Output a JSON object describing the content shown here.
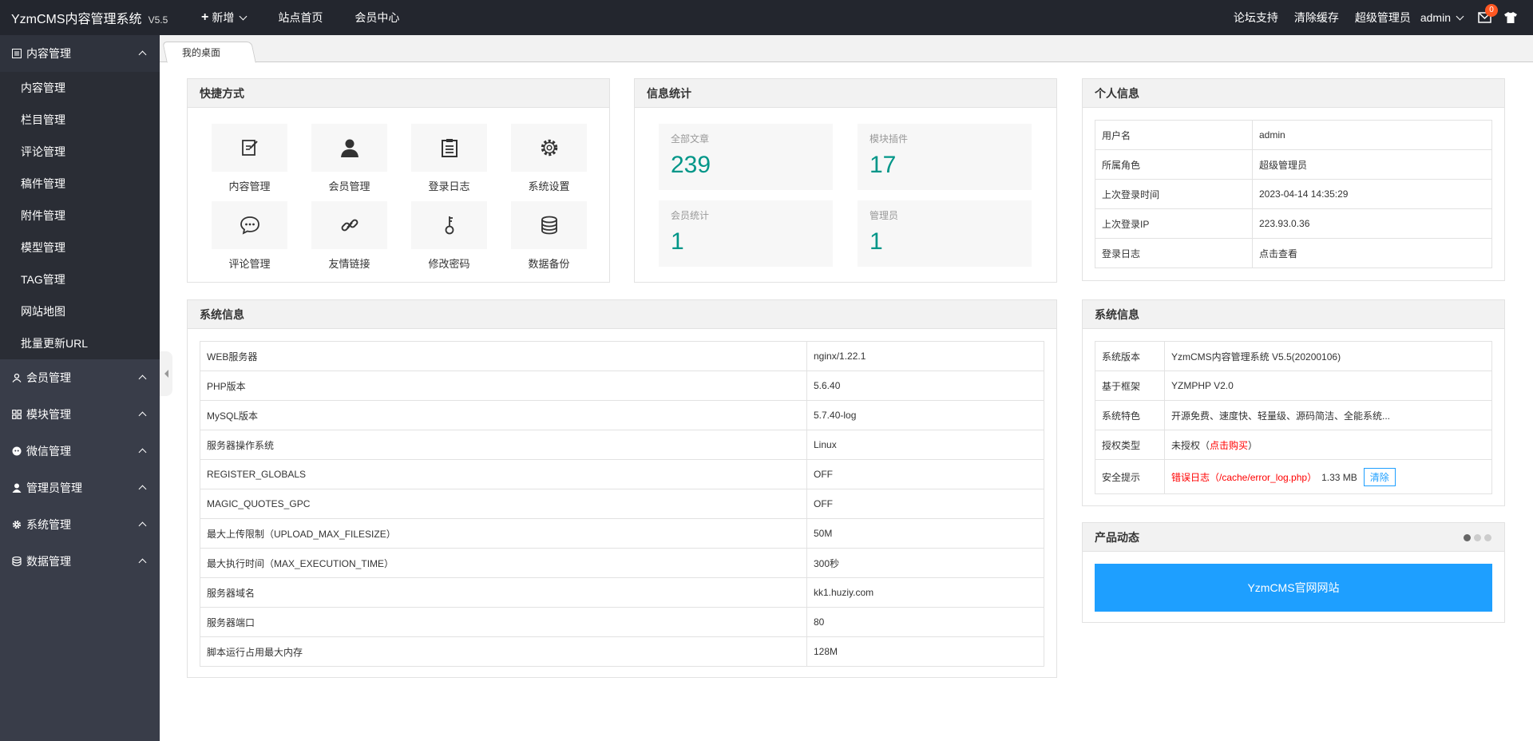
{
  "topbar": {
    "brand": "YzmCMS内容管理系统",
    "version": "V5.5",
    "nav": [
      {
        "label": "新增",
        "icon": "plus-icon"
      },
      {
        "label": "站点首页"
      },
      {
        "label": "会员中心"
      }
    ],
    "right": [
      {
        "label": "论坛支持"
      },
      {
        "label": "清除缓存"
      },
      {
        "label": "超级管理员"
      },
      {
        "label": "admin"
      }
    ],
    "mail_badge": "0"
  },
  "sidebar": {
    "groups": [
      {
        "label": "内容管理",
        "icon": "list-icon",
        "items": [
          "内容管理",
          "栏目管理",
          "评论管理",
          "稿件管理",
          "附件管理",
          "模型管理",
          "TAG管理",
          "网站地图",
          "批量更新URL"
        ]
      },
      {
        "label": "会员管理",
        "icon": "user-icon"
      },
      {
        "label": "模块管理",
        "icon": "grid-icon"
      },
      {
        "label": "微信管理",
        "icon": "wechat-icon"
      },
      {
        "label": "管理员管理",
        "icon": "admin-icon"
      },
      {
        "label": "系统管理",
        "icon": "gear-icon"
      },
      {
        "label": "数据管理",
        "icon": "database-icon"
      }
    ]
  },
  "tabs": [
    "我的桌面"
  ],
  "quick": {
    "title": "快捷方式",
    "items": [
      {
        "label": "内容管理",
        "icon": "edit-icon"
      },
      {
        "label": "会员管理",
        "icon": "person-icon"
      },
      {
        "label": "登录日志",
        "icon": "clipboard-icon"
      },
      {
        "label": "系统设置",
        "icon": "settings-icon"
      },
      {
        "label": "评论管理",
        "icon": "comment-icon"
      },
      {
        "label": "友情链接",
        "icon": "link-icon"
      },
      {
        "label": "修改密码",
        "icon": "key-icon"
      },
      {
        "label": "数据备份",
        "icon": "database-icon"
      }
    ]
  },
  "stats": {
    "title": "信息统计",
    "items": [
      {
        "label": "全部文章",
        "value": "239"
      },
      {
        "label": "模块插件",
        "value": "17"
      },
      {
        "label": "会员统计",
        "value": "1"
      },
      {
        "label": "管理员",
        "value": "1"
      }
    ]
  },
  "personal": {
    "title": "个人信息",
    "rows": [
      {
        "k": "用户名",
        "v": "admin"
      },
      {
        "k": "所属角色",
        "v": "超级管理员"
      },
      {
        "k": "上次登录时间",
        "v": "2023-04-14 14:35:29"
      },
      {
        "k": "上次登录IP",
        "v": "223.93.0.36"
      },
      {
        "k": "登录日志",
        "v": "点击查看"
      }
    ]
  },
  "server": {
    "title": "系统信息",
    "rows": [
      {
        "k": "WEB服务器",
        "v": "nginx/1.22.1"
      },
      {
        "k": "PHP版本",
        "v": "5.6.40"
      },
      {
        "k": "MySQL版本",
        "v": "5.7.40-log"
      },
      {
        "k": "服务器操作系统",
        "v": "Linux"
      },
      {
        "k": "REGISTER_GLOBALS",
        "v": "OFF"
      },
      {
        "k": "MAGIC_QUOTES_GPC",
        "v": "OFF"
      },
      {
        "k": "最大上传限制（UPLOAD_MAX_FILESIZE）",
        "v": "50M"
      },
      {
        "k": "最大执行时间（MAX_EXECUTION_TIME）",
        "v": "300秒"
      },
      {
        "k": "服务器域名",
        "v": "kk1.huziy.com"
      },
      {
        "k": "服务器端口",
        "v": "80"
      },
      {
        "k": "脚本运行占用最大内存",
        "v": "128M"
      }
    ]
  },
  "sysinfo": {
    "title": "系统信息",
    "version_k": "系统版本",
    "version_v": "YzmCMS内容管理系统 V5.5(20200106)",
    "framework_k": "基于框架",
    "framework_v": "YZMPHP V2.0",
    "feature_k": "系统特色",
    "feature_v": "开源免费、速度快、轻量级、源码简洁、全能系统...",
    "license_k": "授权类型",
    "license_v": "未授权（",
    "license_link": "点击购买",
    "license_end": "）",
    "security_k": "安全提示",
    "security_log": "错误日志（/cache/error_log.php）",
    "security_size": "1.33 MB",
    "clear_label": "清除"
  },
  "product": {
    "title": "产品动态",
    "button": "YzmCMS官网网站"
  }
}
